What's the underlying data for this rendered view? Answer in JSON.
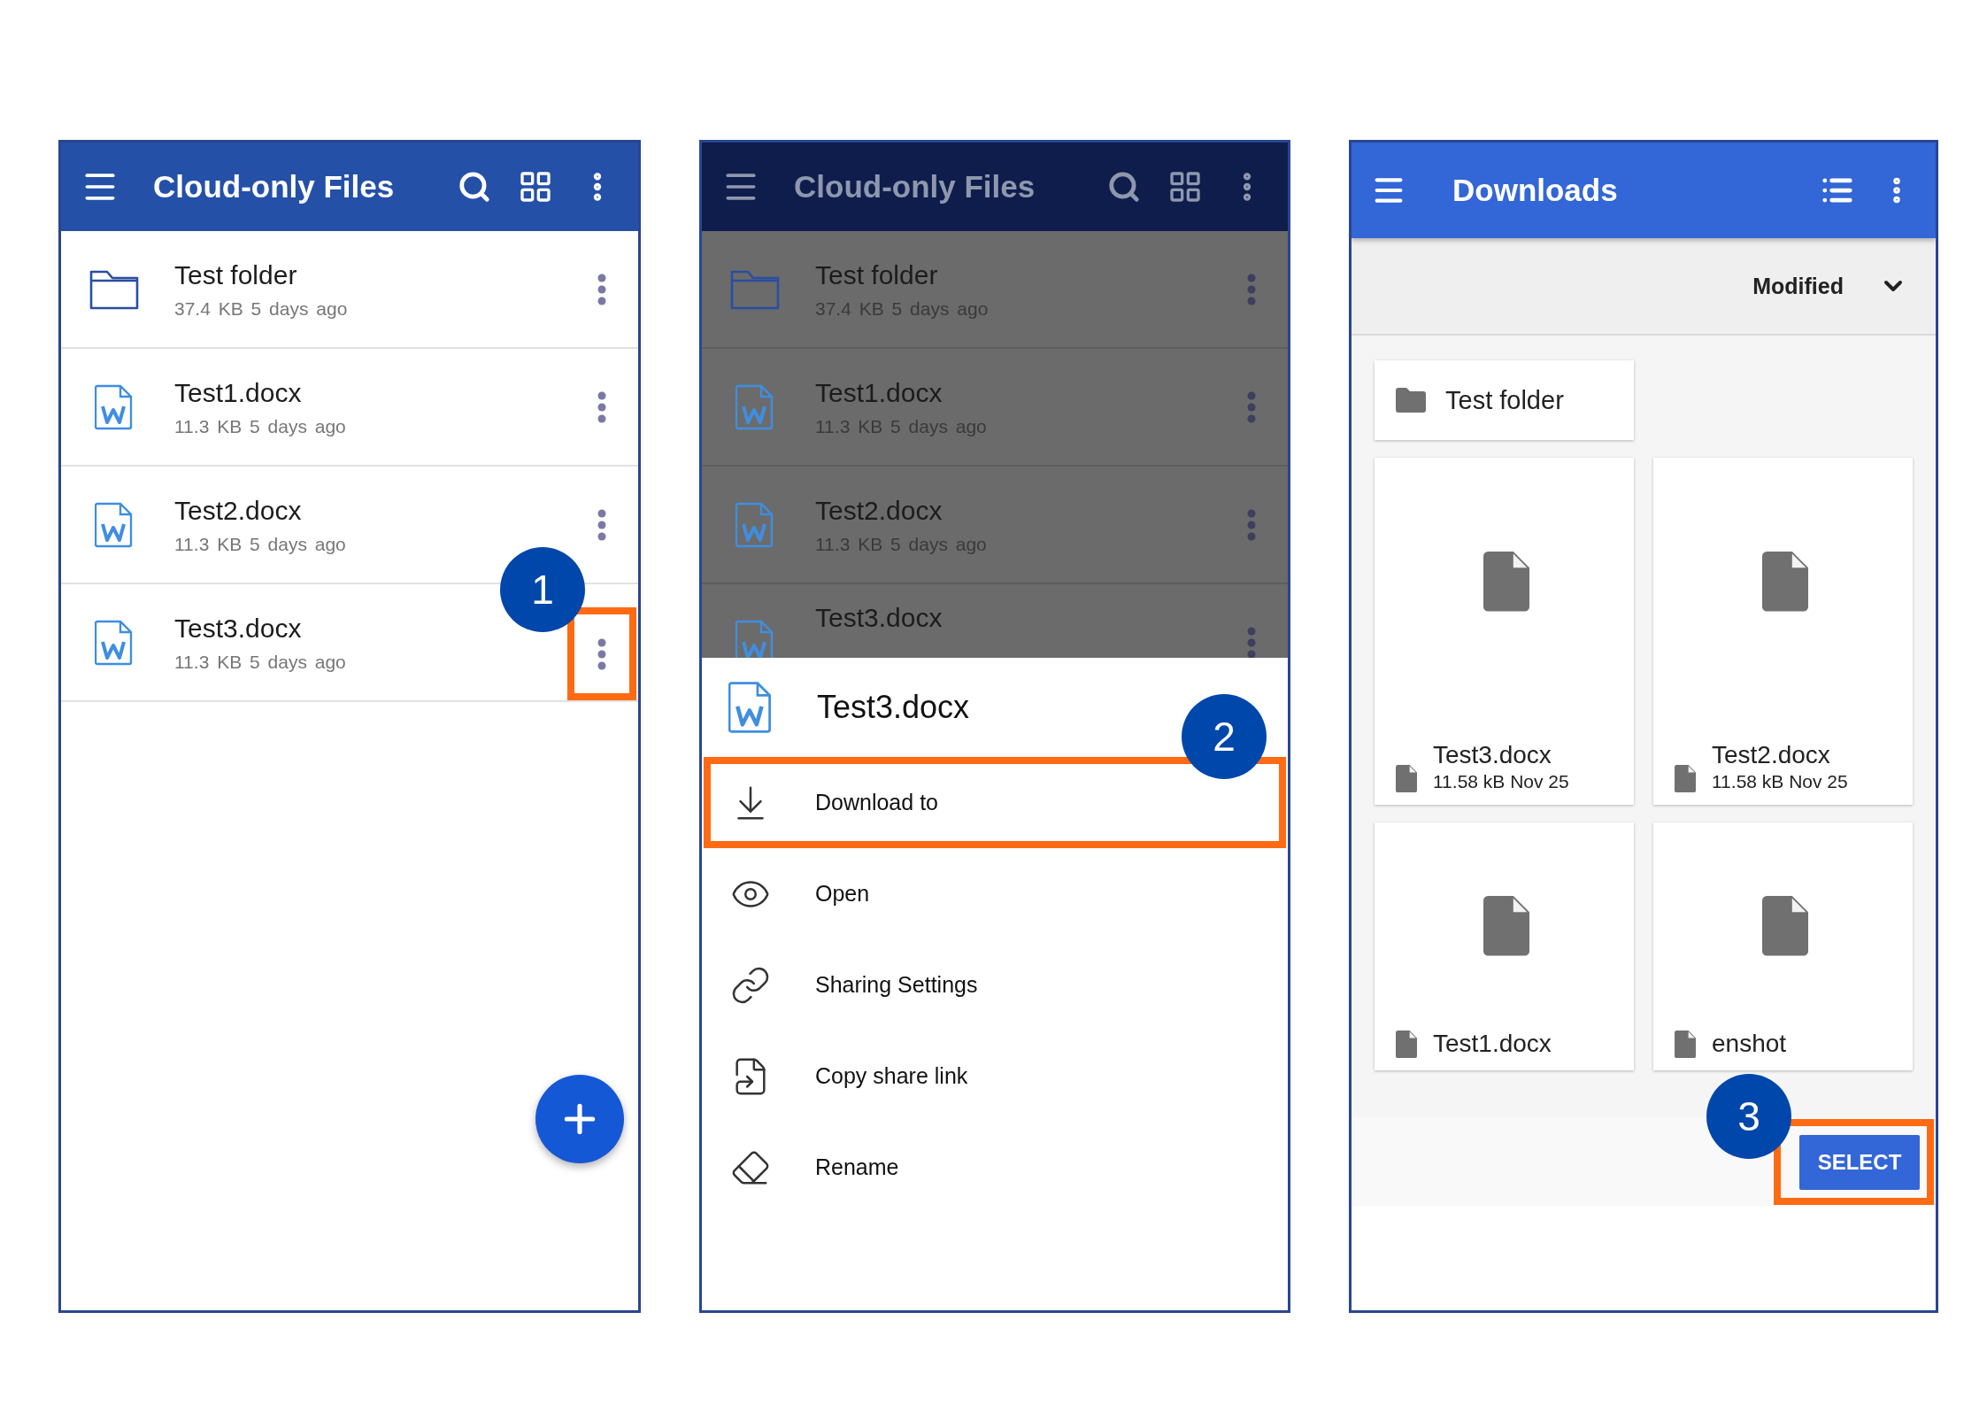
{
  "screens": [
    {
      "kind": "list",
      "title": "Cloud-only Files",
      "dimmed": false,
      "fab": true,
      "step": "1",
      "rows": [
        {
          "kind": "folder",
          "name": "Test folder",
          "size": "37.4 KB",
          "modified": "5 days ago",
          "highlighted": false
        },
        {
          "kind": "doc",
          "name": "Test1.docx",
          "size": "11.3 KB",
          "modified": "5 days ago",
          "highlighted": false
        },
        {
          "kind": "doc",
          "name": "Test2.docx",
          "size": "11.3 KB",
          "modified": "5 days ago",
          "highlighted": false
        },
        {
          "kind": "doc",
          "name": "Test3.docx",
          "size": "11.3 KB",
          "modified": "5 days ago",
          "highlighted": true
        }
      ]
    },
    {
      "kind": "list",
      "title": "Cloud-only Files",
      "dimmed": true,
      "step": "2",
      "rows": [
        {
          "kind": "folder",
          "name": "Test folder",
          "size": "37.4 KB",
          "modified": "5 days ago",
          "highlighted": false
        },
        {
          "kind": "doc",
          "name": "Test1.docx",
          "size": "11.3 KB",
          "modified": "5 days ago",
          "highlighted": false
        },
        {
          "kind": "doc",
          "name": "Test2.docx",
          "size": "11.3 KB",
          "modified": "5 days ago",
          "highlighted": false
        },
        {
          "kind": "doc",
          "name": "Test3.docx",
          "highlighted": false
        }
      ],
      "sheet": {
        "title": "Test3.docx",
        "items": [
          {
            "kind": "download",
            "label": "Download to",
            "highlighted": true
          },
          {
            "kind": "open",
            "label": "Open",
            "highlighted": false
          },
          {
            "kind": "share",
            "label": "Sharing Settings",
            "highlighted": false
          },
          {
            "kind": "copy",
            "label": "Copy share link",
            "highlighted": false
          },
          {
            "kind": "rename",
            "label": "Rename",
            "highlighted": false
          }
        ]
      }
    },
    {
      "kind": "picker",
      "title": "Downloads",
      "step": "3",
      "sort": "Modified",
      "folders": [
        {
          "name": "Test folder"
        }
      ],
      "files": [
        {
          "name": "Test3.docx",
          "meta": "11.58 kB Nov 25"
        },
        {
          "name": "Test2.docx",
          "meta": "11.58 kB Nov 25"
        },
        {
          "name": "Test1.docx"
        },
        {
          "name": "enshot"
        }
      ],
      "button": {
        "label": "SELECT",
        "highlighted": true
      }
    }
  ]
}
